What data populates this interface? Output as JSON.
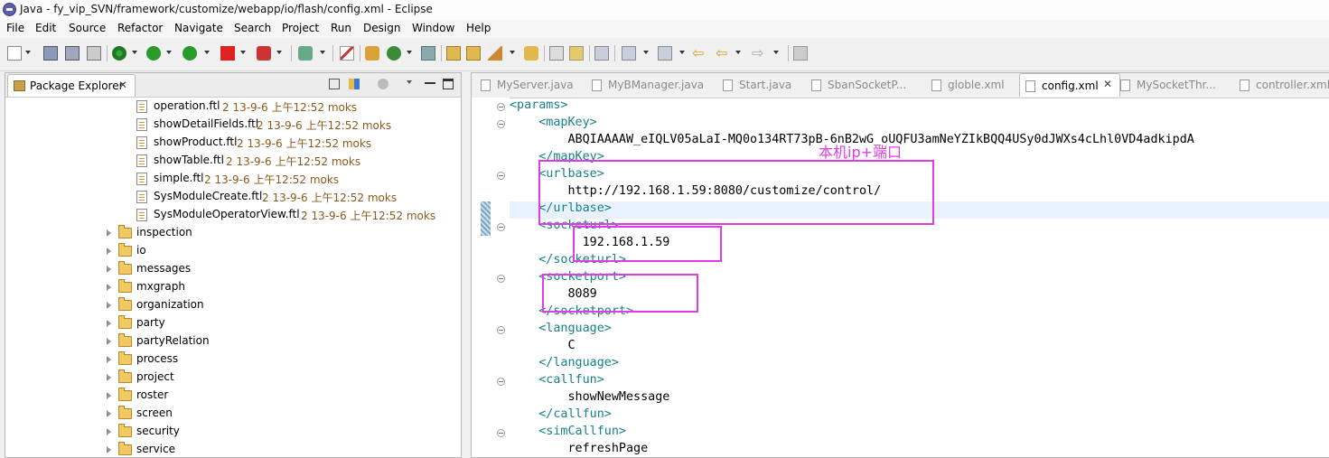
{
  "window": {
    "title": "Java - fy_vip_SVN/framework/customize/webapp/io/flash/config.xml - Eclipse",
    "icon": "eclipse-icon"
  },
  "menu": [
    "File",
    "Edit",
    "Source",
    "Refactor",
    "Navigate",
    "Search",
    "Project",
    "Run",
    "Design",
    "Window",
    "Help"
  ],
  "package_explorer": {
    "tab_label": "Package Explorer",
    "close_glyph": "✕",
    "files": [
      {
        "name": "operation.ftl",
        "meta": "2  13-9-6 上午12:52  moks"
      },
      {
        "name": "showDetailFields.ftl",
        "meta": "2  13-9-6 上午12:52  moks"
      },
      {
        "name": "showProduct.ftl",
        "meta": "2  13-9-6 上午12:52  moks"
      },
      {
        "name": "showTable.ftl",
        "meta": "2  13-9-6 上午12:52  moks"
      },
      {
        "name": "simple.ftl",
        "meta": "2  13-9-6 上午12:52  moks"
      },
      {
        "name": "SysModuleCreate.ftl",
        "meta": "2  13-9-6 上午12:52  moks"
      },
      {
        "name": "SysModuleOperatorView.ftl",
        "meta": "2  13-9-6 上午12:52  moks"
      }
    ],
    "folders": [
      "inspection",
      "io",
      "messages",
      "mxgraph",
      "organization",
      "party",
      "partyRelation",
      "process",
      "project",
      "roster",
      "screen",
      "security",
      "service"
    ]
  },
  "editor_tabs": [
    {
      "label": "MyServer.java",
      "active": false
    },
    {
      "label": "MyBManager.java",
      "active": false
    },
    {
      "label": "Start.java",
      "active": false
    },
    {
      "label": "SbanSocketP...",
      "active": false
    },
    {
      "label": "globle.xml",
      "active": false
    },
    {
      "label": "config.xml",
      "active": true
    },
    {
      "label": "MySocketThr...",
      "active": false
    },
    {
      "label": "controller.xml",
      "active": false
    }
  ],
  "code_lines": [
    {
      "indent": "",
      "tag": "<params>",
      "text": ""
    },
    {
      "indent": "    ",
      "tag": "<mapKey>",
      "text": ""
    },
    {
      "indent": "        ",
      "tag": "",
      "text": "ABQIAAAAW_eIQLV05aLaI-MQ0o134RT73pB-6nB2wG_oUQFU3amNeYZIkBQQ4USy0dJWXs4cLhl0VD4adkipdA"
    },
    {
      "indent": "    ",
      "tag": "</mapKey>",
      "text": ""
    },
    {
      "indent": "    ",
      "tag": "<urlbase>",
      "text": ""
    },
    {
      "indent": "        ",
      "tag": "",
      "text": "http://192.168.1.59:8080/customize/control/"
    },
    {
      "indent": "    ",
      "tag": "</urlbase>",
      "text": ""
    },
    {
      "indent": "    ",
      "tag": "<socketurl>",
      "text": ""
    },
    {
      "indent": "          ",
      "tag": "",
      "text": "192.168.1.59"
    },
    {
      "indent": "    ",
      "tag": "</socketurl>",
      "text": ""
    },
    {
      "indent": "    ",
      "tag": "<socketport>",
      "text": ""
    },
    {
      "indent": "        ",
      "tag": "",
      "text": "8089"
    },
    {
      "indent": "    ",
      "tag": "</socketport>",
      "text": ""
    },
    {
      "indent": "    ",
      "tag": "<language>",
      "text": ""
    },
    {
      "indent": "        ",
      "tag": "",
      "text": "C"
    },
    {
      "indent": "    ",
      "tag": "</language>",
      "text": ""
    },
    {
      "indent": "    ",
      "tag": "<callfun>",
      "text": ""
    },
    {
      "indent": "        ",
      "tag": "",
      "text": "showNewMessage"
    },
    {
      "indent": "    ",
      "tag": "</callfun>",
      "text": ""
    },
    {
      "indent": "    ",
      "tag": "<simCallfun>",
      "text": ""
    },
    {
      "indent": "        ",
      "tag": "",
      "text": "refreshPage"
    }
  ],
  "annotation": {
    "note": "本机ip+端口",
    "color": "#e03ce6"
  },
  "colors": {
    "tag": "#17808a",
    "meta": "#8b5a1c",
    "highlight": "#e03ce6"
  }
}
